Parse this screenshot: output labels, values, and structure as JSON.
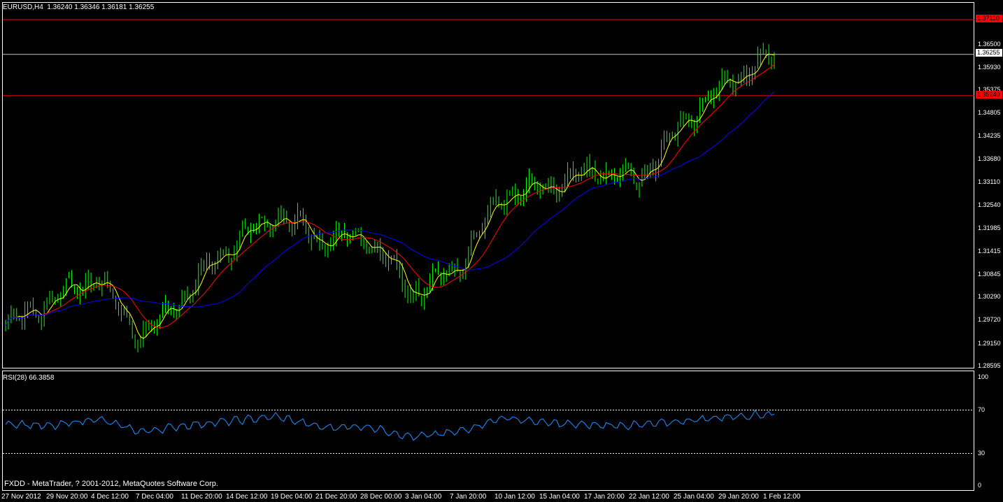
{
  "main_chart": {
    "title": "EURUSD,H4  1.36240 1.36346 1.36181 1.36255",
    "price_ticks": [
      "1.36500",
      "1.35930",
      "1.35375",
      "1.34805",
      "1.34235",
      "1.33680",
      "1.33110",
      "1.32540",
      "1.31985",
      "1.31415",
      "1.30845",
      "1.30290",
      "1.29720",
      "1.29150",
      "1.28595"
    ],
    "current_price": "1.36255",
    "resistance_price": "1.37110",
    "support_price": "1.35240",
    "colors": {
      "bars": "#00ff00",
      "fast_ma": "#ffff00",
      "mid_ma": "#ff0000",
      "slow_ma": "#0000ff",
      "hline": "#ff0000",
      "current": "#c0c0c0"
    }
  },
  "rsi_chart": {
    "title": "RSI(28) 66.3858",
    "levels": [
      "100",
      "70",
      "30",
      "0"
    ],
    "color": "#1e90ff"
  },
  "time_axis": [
    "27 Nov 2012",
    "29 Nov 20:00",
    "4 Dec 12:00",
    "7 Dec 04:00",
    "11 Dec 20:00",
    "14 Dec 12:00",
    "19 Dec 04:00",
    "21 Dec 20:00",
    "28 Dec 00:00",
    "3 Jan 04:00",
    "7 Jan 20:00",
    "10 Jan 12:00",
    "15 Jan 04:00",
    "17 Jan 20:00",
    "22 Jan 12:00",
    "25 Jan 04:00",
    "29 Jan 20:00",
    "1 Feb 12:00"
  ],
  "copyright": "FXDD - MetaTrader, ? 2001-2012, MetaQuotes Software Corp.",
  "chart_data": {
    "type": "line",
    "title": "EURUSD,H4",
    "x": [
      "27 Nov 2012",
      "29 Nov 20:00",
      "4 Dec 12:00",
      "7 Dec 04:00",
      "11 Dec 20:00",
      "14 Dec 12:00",
      "19 Dec 04:00",
      "21 Dec 20:00",
      "28 Dec 00:00",
      "3 Jan 04:00",
      "7 Jan 20:00",
      "10 Jan 12:00",
      "15 Jan 04:00",
      "17 Jan 20:00",
      "22 Jan 12:00",
      "25 Jan 04:00",
      "29 Jan 20:00",
      "1 Feb 12:00"
    ],
    "series": [
      {
        "name": "EURUSD,H4",
        "values": [
          1.296,
          1.302,
          1.308,
          1.293,
          1.304,
          1.316,
          1.323,
          1.317,
          1.318,
          1.304,
          1.31,
          1.328,
          1.33,
          1.334,
          1.332,
          1.346,
          1.356,
          1.3625
        ]
      },
      {
        "name": "RSI(28)",
        "values": [
          58,
          55,
          62,
          50,
          56,
          60,
          64,
          54,
          55,
          45,
          50,
          63,
          58,
          56,
          56,
          60,
          64,
          66.3858
        ]
      }
    ],
    "ylim": [
      1.28595,
      1.3711
    ]
  }
}
